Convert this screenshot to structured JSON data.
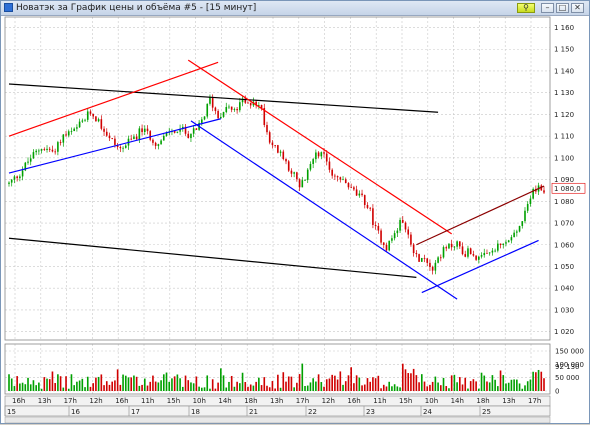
{
  "window": {
    "title": "Новатэк за График цены и объёма #5 - [15 минут]",
    "pin_glyph": "⚲",
    "min_glyph": "–",
    "max_glyph": "□",
    "close_glyph": "✕"
  },
  "chart_data": {
    "type": "candlestick",
    "price_axis": {
      "ticks": [
        "1 160",
        "1 150",
        "1 140",
        "1 130",
        "1 120",
        "1 110",
        "1 100",
        "1 090",
        "1 080",
        "1 070",
        "1 060",
        "1 050",
        "1 040",
        "1 030",
        "1 020"
      ],
      "values": [
        1160,
        1150,
        1140,
        1130,
        1120,
        1110,
        1100,
        1090,
        1080,
        1070,
        1060,
        1050,
        1040,
        1030,
        1020
      ],
      "range": [
        1018,
        1163
      ],
      "last_price_label": "1 080,0",
      "last_price": 1086,
      "last_price_color": "#e00000"
    },
    "volume_axis": {
      "ticks": [
        "150 000",
        "100 000",
        "50 000",
        "0"
      ],
      "values": [
        150000,
        100000,
        50000,
        0
      ],
      "range": [
        0,
        165000
      ],
      "last_volume_label": "92 130",
      "last_volume": 92130,
      "last_volume_color": "#e00000"
    },
    "time_axis": {
      "hour_labels": [
        "16h",
        "13h",
        "17h",
        "12h",
        "16h",
        "11h",
        "15h",
        "10h",
        "14h",
        "18h",
        "13h",
        "17h",
        "12h",
        "16h",
        "11h",
        "15h",
        "10h",
        "14h",
        "18h",
        "13h",
        "17h"
      ],
      "day_labels": [
        "15",
        "16",
        "17",
        "18",
        "21",
        "22",
        "23",
        "24",
        "25"
      ]
    },
    "colors": {
      "up": "#00a000",
      "down": "#d00000",
      "resistance": "#ff0000",
      "support": "#0000ff",
      "channel": "#000000",
      "dark_red": "#8b0000"
    },
    "price_path": [
      [
        0,
        1088
      ],
      [
        4,
        1093
      ],
      [
        8,
        1100
      ],
      [
        12,
        1105
      ],
      [
        16,
        1103
      ],
      [
        20,
        1110
      ],
      [
        24,
        1112
      ],
      [
        28,
        1118
      ],
      [
        30,
        1121
      ],
      [
        33,
        1117
      ],
      [
        37,
        1109
      ],
      [
        41,
        1104
      ],
      [
        45,
        1108
      ],
      [
        49,
        1113
      ],
      [
        52,
        1110
      ],
      [
        55,
        1106
      ],
      [
        59,
        1112
      ],
      [
        63,
        1113
      ],
      [
        66,
        1111
      ],
      [
        69,
        1112
      ],
      [
        72,
        1120
      ],
      [
        74,
        1127
      ],
      [
        77,
        1119
      ],
      [
        80,
        1124
      ],
      [
        83,
        1121
      ],
      [
        86,
        1126
      ],
      [
        88,
        1124
      ],
      [
        90,
        1127
      ],
      [
        93,
        1122
      ],
      [
        95,
        1112
      ],
      [
        97,
        1106
      ],
      [
        99,
        1103
      ],
      [
        102,
        1098
      ],
      [
        105,
        1092
      ],
      [
        107,
        1086
      ],
      [
        110,
        1093
      ],
      [
        113,
        1104
      ],
      [
        116,
        1100
      ],
      [
        119,
        1093
      ],
      [
        122,
        1090
      ],
      [
        125,
        1087
      ],
      [
        128,
        1083
      ],
      [
        131,
        1080
      ],
      [
        133,
        1075
      ],
      [
        135,
        1067
      ],
      [
        137,
        1063
      ],
      [
        139,
        1059
      ],
      [
        142,
        1065
      ],
      [
        145,
        1072
      ],
      [
        147,
        1066
      ],
      [
        149,
        1058
      ],
      [
        151,
        1052
      ],
      [
        153,
        1054
      ],
      [
        156,
        1050
      ],
      [
        159,
        1056
      ],
      [
        162,
        1059
      ],
      [
        165,
        1061
      ],
      [
        167,
        1056
      ],
      [
        170,
        1057
      ],
      [
        173,
        1053
      ],
      [
        176,
        1055
      ],
      [
        179,
        1058
      ],
      [
        182,
        1060
      ],
      [
        185,
        1063
      ],
      [
        188,
        1068
      ],
      [
        190,
        1074
      ],
      [
        193,
        1084
      ],
      [
        195,
        1086
      ]
    ],
    "annotations": [
      {
        "name": "upper-channel-line",
        "color": "#000000",
        "from": [
          0,
          1134
        ],
        "to": [
          158,
          1121
        ]
      },
      {
        "name": "lower-channel-line",
        "color": "#000000",
        "from": [
          0,
          1063
        ],
        "to": [
          150,
          1045
        ]
      },
      {
        "name": "rising-resistance-line",
        "color": "#ff0000",
        "from": [
          0,
          1110
        ],
        "to": [
          77,
          1144
        ]
      },
      {
        "name": "rising-support-line",
        "color": "#0000ff",
        "from": [
          0,
          1093
        ],
        "to": [
          78,
          1118
        ]
      },
      {
        "name": "falling-resistance-line",
        "color": "#ff0000",
        "from": [
          66,
          1145
        ],
        "to": [
          163,
          1065
        ]
      },
      {
        "name": "falling-support-line",
        "color": "#0000ff",
        "from": [
          67,
          1117
        ],
        "to": [
          165,
          1035
        ]
      },
      {
        "name": "recent-resistance-line",
        "color": "#8b0000",
        "from": [
          150,
          1060
        ],
        "to": [
          197,
          1087
        ]
      },
      {
        "name": "recent-support-line",
        "color": "#0000ff",
        "from": [
          152,
          1038
        ],
        "to": [
          195,
          1062
        ]
      }
    ]
  }
}
